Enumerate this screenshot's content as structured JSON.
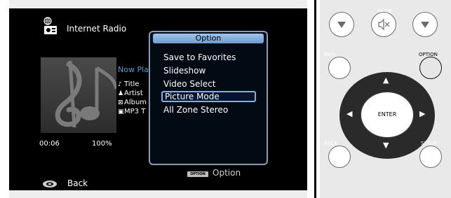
{
  "osd": {
    "source_title": "Internet Radio",
    "now_playing": "Now Playing",
    "meta": [
      {
        "icon": "note-icon",
        "glyph": "♪",
        "label": "Title"
      },
      {
        "icon": "artist-icon",
        "glyph": "♟",
        "label": "Artist"
      },
      {
        "icon": "album-icon",
        "glyph": "⊠",
        "label": "Album"
      },
      {
        "icon": "format-icon",
        "glyph": "▣",
        "label": "MP3 T"
      }
    ],
    "elapsed": "00:06",
    "progress": "100%",
    "back_label": "Back",
    "option_hint_button": "OPTION",
    "option_hint_label": "Option"
  },
  "popup": {
    "title": "Option",
    "items": [
      "Save to Favorites",
      "Slideshow",
      "Video Select",
      "Picture Mode",
      "All Zone Stereo"
    ],
    "selected": "Picture Mode"
  },
  "remote": {
    "top_labels": [
      "",
      "MUTE",
      ""
    ],
    "info_label": "INFO",
    "option_label": "OPTION",
    "enter_label": "ENTER",
    "back_label": "BACK",
    "setup_label": "SETUP"
  },
  "colors": {
    "accent_blue": "#4f9fd9",
    "popup_title_bg": "#9fc5ec",
    "popup_border": "#8a9cb2",
    "selection_border": "#7fb0e6"
  }
}
